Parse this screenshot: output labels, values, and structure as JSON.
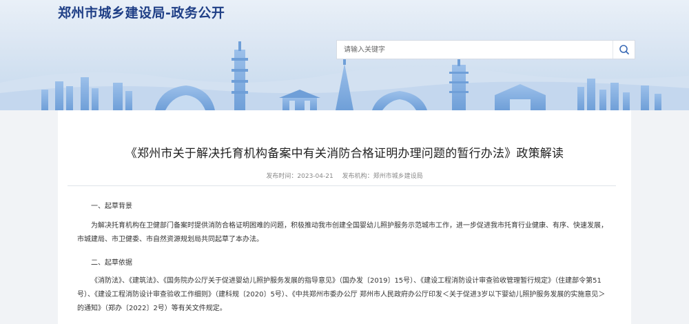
{
  "header": {
    "site_title": "郑州市城乡建设局-政务公开",
    "search_placeholder": "请输入关键字"
  },
  "icons": {
    "search": "search-icon"
  },
  "colors": {
    "title": "#1f3f86",
    "search_icon": "#3a6ab5",
    "skyline": "#8fb3e0"
  },
  "article": {
    "title": "《郑州市关于解决托育机构备案中有关消防合格证明办理问题的暂行办法》政策解读",
    "publish_time": "发布时间：2023-04-21",
    "source": "发布机构：郑州市城乡建设局",
    "section1_head": "一、起草背景",
    "section1_para": "为解决托育机构在卫健部门备案时提供消防合格证明困难的问题，积极推动我市创建全国婴幼儿照护服务示范城市工作，进一步促进我市托育行业健康、有序、快速发展，市城建局、市卫健委、市自然资源规划局共同起草了本办法。",
    "section2_head": "二、起草依据",
    "section2_para": "《消防法》、《建筑法》、《国务院办公厅关于促进婴幼儿照护服务发展的指导意见》（国办发〔2019〕15号）、《建设工程消防设计审查验收管理暂行规定》（住建部令第51号）、《建设工程消防设计审查验收工作细则》（建科规〔2020〕5号）、《中共郑州市委办公厅 郑州市人民政府办公厅印发＜关于促进3岁以下婴幼儿照护服务发展的实施意见＞的通知》（郑办〔2022〕2号）等有关文件规定。"
  }
}
